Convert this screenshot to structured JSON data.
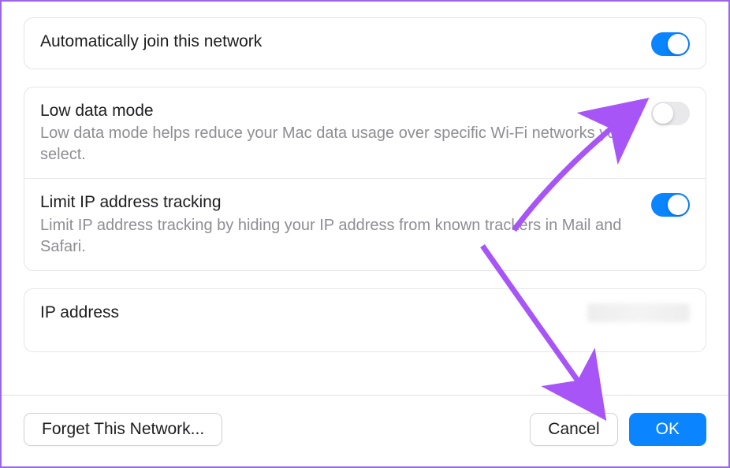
{
  "settings": {
    "auto_join": {
      "label": "Automatically join this network",
      "enabled": true
    },
    "low_data": {
      "label": "Low data mode",
      "description": "Low data mode helps reduce your Mac data usage over specific Wi-Fi networks you select.",
      "enabled": false
    },
    "limit_ip": {
      "label": "Limit IP address tracking",
      "description": "Limit IP address tracking by hiding your IP address from known trackers in Mail and Safari.",
      "enabled": true
    },
    "ip_address": {
      "label": "IP address"
    }
  },
  "footer": {
    "forget_label": "Forget This Network...",
    "cancel_label": "Cancel",
    "ok_label": "OK"
  }
}
